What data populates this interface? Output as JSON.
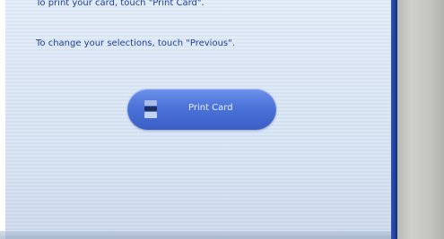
{
  "screen": {
    "instructions": {
      "print_hint": "To print your card, touch \"Print Card\".",
      "previous_hint": "To change your selections, touch \"Previous\"."
    },
    "print_button": {
      "label": "Print Card",
      "icon": "card-icon"
    }
  },
  "colors": {
    "screen_background": "#dbe6f4",
    "text": "#1e3f8f",
    "button": "#4b73d8",
    "button_text": "#e8eefc",
    "screen_edge": "#1f3f9a",
    "bezel": "#c4c4bf"
  }
}
